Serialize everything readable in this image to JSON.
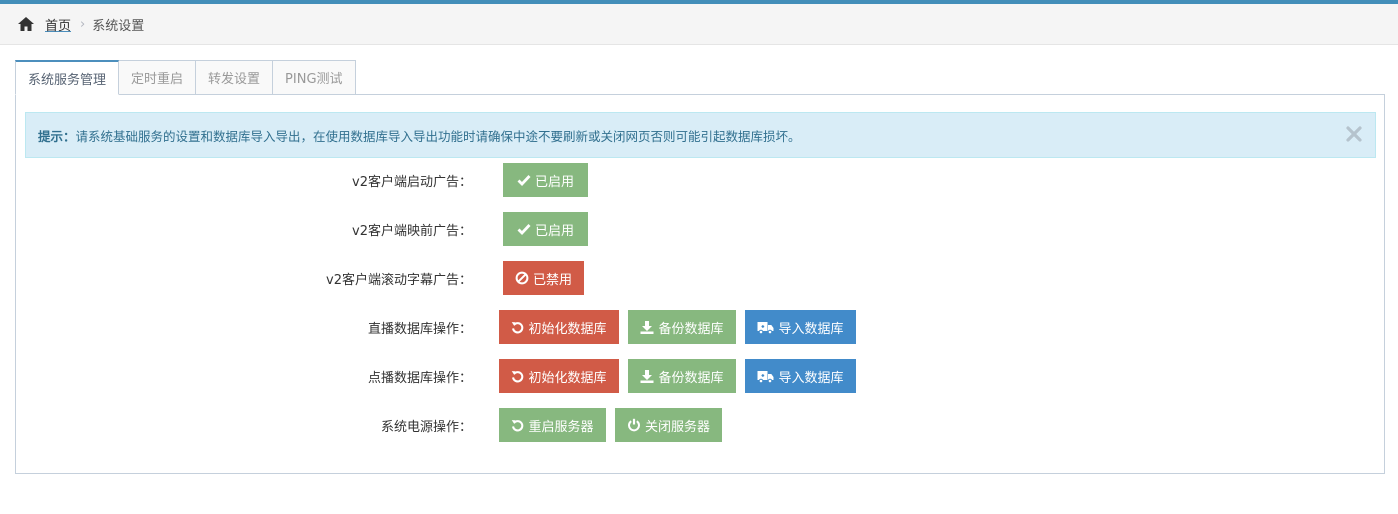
{
  "breadcrumbs": {
    "home": "首页",
    "current": "系统设置",
    "separator": "›"
  },
  "tabs": [
    {
      "label": "系统服务管理",
      "active": true
    },
    {
      "label": "定时重启",
      "active": false
    },
    {
      "label": "转发设置",
      "active": false
    },
    {
      "label": "PING测试",
      "active": false
    }
  ],
  "alert": {
    "prefix": "提示：",
    "text": "请系统基础服务的设置和数据库导入导出，在使用数据库导入导出功能时请确保中途不要刷新或关闭网页否则可能引起数据库损坏。"
  },
  "rows": [
    {
      "label": "v2客户端启动广告：",
      "buttons": [
        {
          "label": "已启用",
          "icon": "check-icon",
          "style": "success"
        }
      ]
    },
    {
      "label": "v2客户端映前广告：",
      "buttons": [
        {
          "label": "已启用",
          "icon": "check-icon",
          "style": "success"
        }
      ]
    },
    {
      "label": "v2客户端滚动字幕广告：",
      "buttons": [
        {
          "label": "已禁用",
          "icon": "ban-icon",
          "style": "danger"
        }
      ]
    },
    {
      "label": "直播数据库操作：",
      "buttons": [
        {
          "label": "初始化数据库",
          "icon": "undo-icon",
          "style": "danger"
        },
        {
          "label": "备份数据库",
          "icon": "download-icon",
          "style": "success"
        },
        {
          "label": "导入数据库",
          "icon": "truck-icon",
          "style": "primary"
        }
      ]
    },
    {
      "label": "点播数据库操作：",
      "buttons": [
        {
          "label": "初始化数据库",
          "icon": "undo-icon",
          "style": "danger"
        },
        {
          "label": "备份数据库",
          "icon": "download-icon",
          "style": "success"
        },
        {
          "label": "导入数据库",
          "icon": "truck-icon",
          "style": "primary"
        }
      ]
    },
    {
      "label": "系统电源操作：",
      "buttons": [
        {
          "label": "重启服务器",
          "icon": "undo-icon",
          "style": "success"
        },
        {
          "label": "关闭服务器",
          "icon": "power-icon",
          "style": "success"
        }
      ]
    }
  ],
  "colors": {
    "success": "#87b87f",
    "danger": "#d15b47",
    "primary": "#428bca",
    "accent": "#438eb9"
  }
}
